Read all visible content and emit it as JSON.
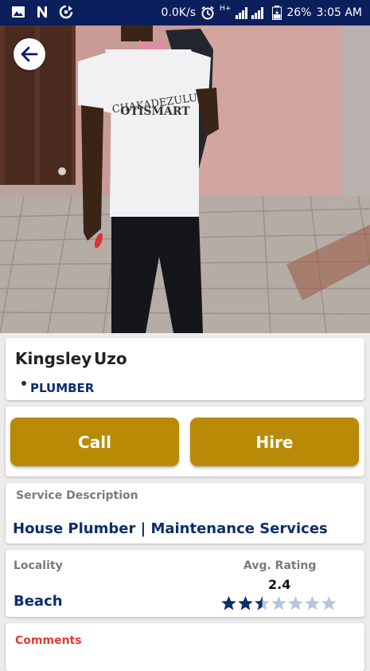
{
  "status_bar": {
    "net_speed": "0.0K/s",
    "network_type": "H+",
    "battery": "26%",
    "time": "3:05 AM",
    "icons": [
      "image-icon",
      "n-icon",
      "sync-icon",
      "alarm-icon",
      "signal-icon",
      "battery-icon"
    ]
  },
  "nav": {
    "back_icon": "arrow-left-icon"
  },
  "profile": {
    "first_name": "Kingsley",
    "last_name": "Uzo",
    "profession": "PLUMBER",
    "shirt_print_top": "CHAKADEZULU",
    "shirt_print_bottom": "OTISMART"
  },
  "actions": {
    "call_label": "Call",
    "hire_label": "Hire"
  },
  "service": {
    "label": "Service Description",
    "value": "House Plumber | Maintenance Services"
  },
  "locality": {
    "label": "Locality",
    "value": "Beach"
  },
  "rating": {
    "label": "Avg. Rating",
    "value": "2.4",
    "stars_total": 7,
    "stars_filled": 2.4,
    "filled_color": "#0d2d6b",
    "empty_color": "#b8c6d8"
  },
  "comments": {
    "label": "Comments"
  },
  "colors": {
    "status_bar": "#0a1f5c",
    "primary_button": "#b88a05",
    "accent_text": "#0d2d6b",
    "comments_label": "#e53935"
  }
}
